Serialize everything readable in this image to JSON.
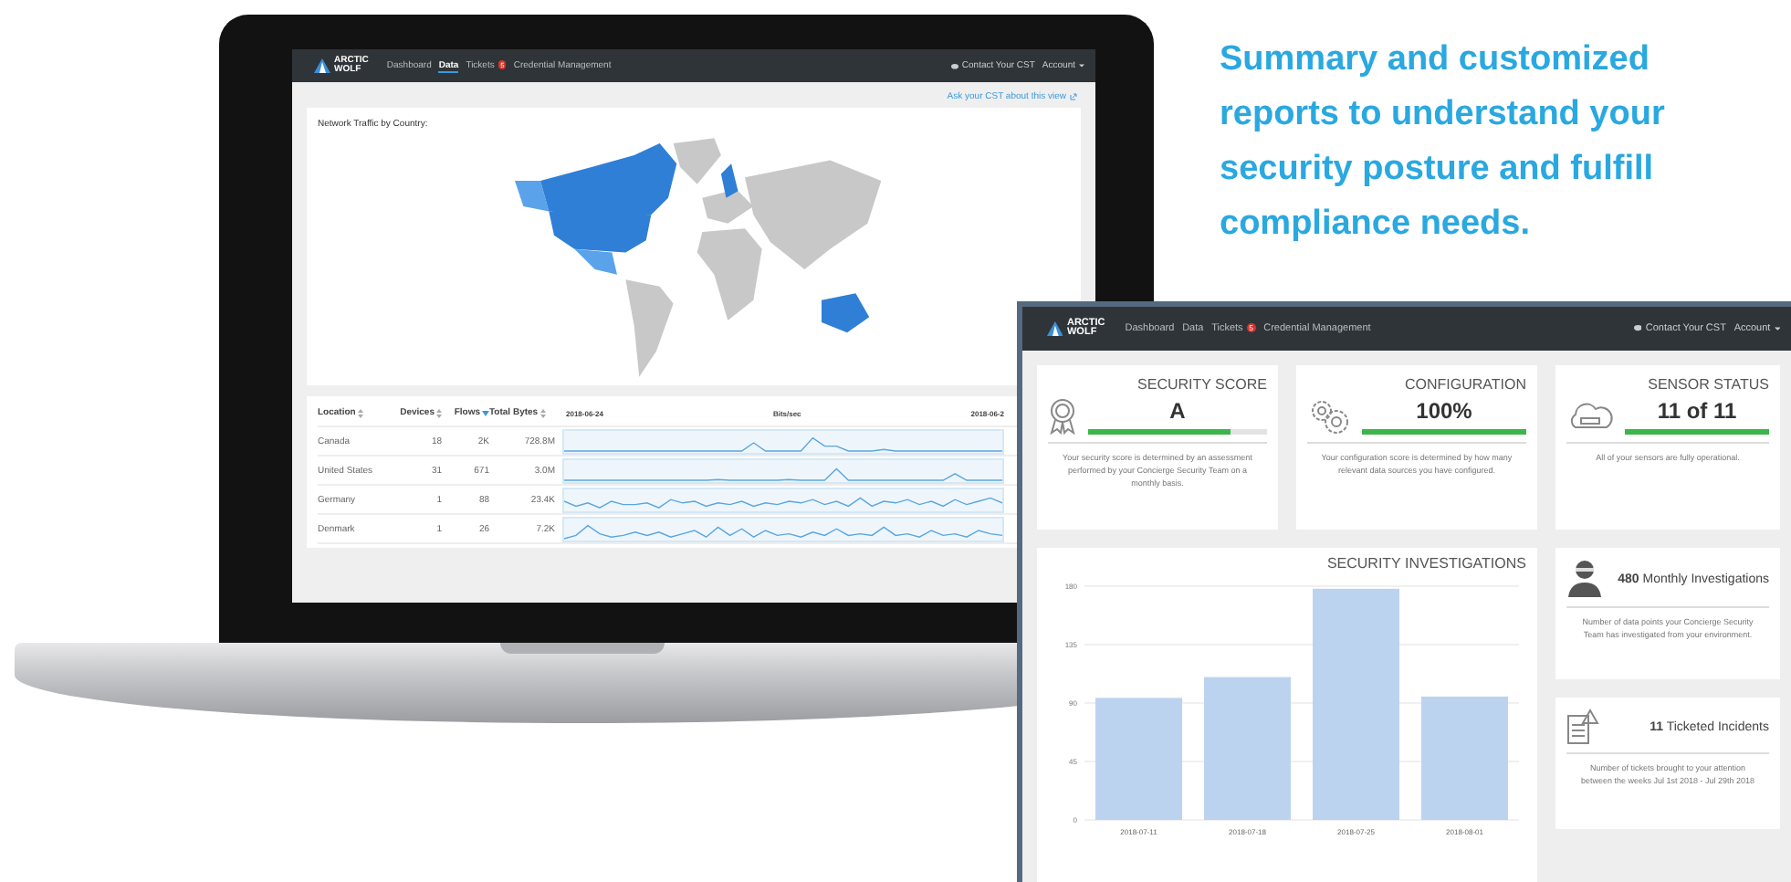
{
  "marketing": {
    "headline": "Summary and customized reports to understand your security posture and fulfill compliance needs."
  },
  "laptop_screen": {
    "nav": {
      "logo": [
        "ARCTIC",
        "WOLF"
      ],
      "items": [
        {
          "label": "Dashboard",
          "selected": false
        },
        {
          "label": "Data",
          "selected": true
        },
        {
          "label": "Tickets",
          "selected": false,
          "badge": "5"
        },
        {
          "label": "Credential Management",
          "selected": false
        }
      ],
      "contact": "Contact Your CST",
      "account": "Account"
    },
    "ask_link": "Ask your CST about this view",
    "map_card": {
      "title": "Network Traffic by Country:"
    },
    "table": {
      "columns": [
        {
          "label": "Location",
          "sorted": false
        },
        {
          "label": "Devices",
          "sorted": false
        },
        {
          "label": "Flows",
          "sorted": true
        },
        {
          "label": "Total Bytes",
          "sorted": false
        }
      ],
      "chart_header": [
        "2018-06-24",
        "Bits/sec",
        "2018-06-2"
      ],
      "rows": [
        {
          "location": "Canada",
          "devices": "18",
          "flows": "2K",
          "total_bytes": "728.8M"
        },
        {
          "location": "United States",
          "devices": "31",
          "flows": "671",
          "total_bytes": "3.0M"
        },
        {
          "location": "Germany",
          "devices": "1",
          "flows": "88",
          "total_bytes": "23.4K"
        },
        {
          "location": "Denmark",
          "devices": "1",
          "flows": "26",
          "total_bytes": "7.2K"
        }
      ]
    }
  },
  "dashboard_window": {
    "nav": {
      "logo": [
        "ARCTIC",
        "WOLF"
      ],
      "items": [
        {
          "label": "Dashboard",
          "selected": false
        },
        {
          "label": "Data",
          "selected": false
        },
        {
          "label": "Tickets",
          "selected": false,
          "badge": "5"
        },
        {
          "label": "Credential Management",
          "selected": false
        }
      ],
      "contact": "Contact Your CST",
      "account": "Account"
    },
    "cards": [
      {
        "kind": "ribbon",
        "title": "SECURITY SCORE",
        "value": "A",
        "level": 0.8,
        "description": "Your security score is determined by an assessment performed by your Concierge Security Team on a monthly basis."
      },
      {
        "kind": "gears",
        "title": "CONFIGURATION",
        "value": "100%",
        "level": 1,
        "description": "Your configuration score is determined by how many relevant data sources you have configured."
      },
      {
        "kind": "cloud",
        "title": "SENSOR STATUS",
        "value": "11 of 11",
        "level": 1,
        "description": "All of your sensors are fully operational."
      }
    ],
    "investigations_chart": {
      "chart_data": {
        "type": "bar",
        "title": "SECURITY INVESTIGATIONS",
        "categories": [
          "2018-07-11",
          "2018-07-18",
          "2018-07-25",
          "2018-08-01"
        ],
        "values": [
          94,
          110,
          178,
          95
        ],
        "ylim": [
          0,
          180
        ],
        "grid": true,
        "yticks": [
          0,
          45,
          90,
          135,
          180
        ]
      }
    },
    "side_cards": [
      {
        "kind": "agent",
        "headline": "**480** Monthly Investigations",
        "description": "Number of data points your Concierge Security Team has investigated from your environment."
      },
      {
        "kind": "document",
        "headline": "**11** Ticketed Incidents",
        "description": "Number of tickets brought to your attention between the weeks Jul 1st 2018 - Jul 29th 2018"
      }
    ]
  }
}
